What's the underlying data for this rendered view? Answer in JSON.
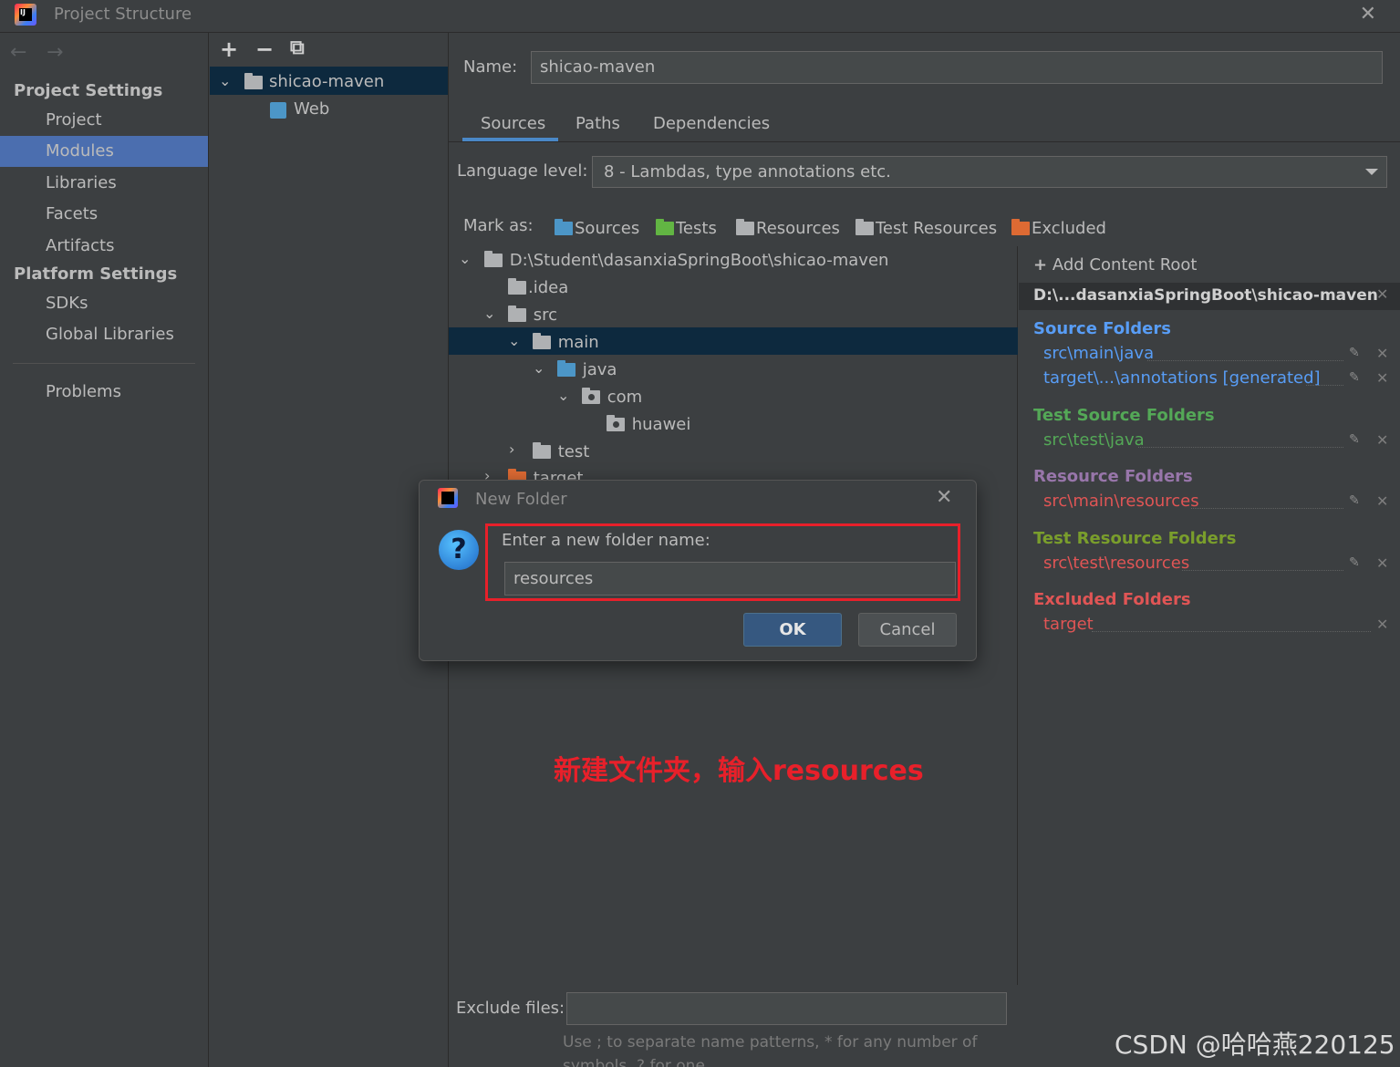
{
  "window": {
    "title": "Project Structure",
    "close": "✕"
  },
  "nav": {
    "back": "←",
    "forward": "→",
    "project_settings": "Project Settings",
    "project_items": [
      "Project",
      "Modules",
      "Libraries",
      "Facets",
      "Artifacts"
    ],
    "platform_settings": "Platform Settings",
    "platform_items": [
      "SDKs",
      "Global Libraries"
    ],
    "problems": "Problems"
  },
  "modules": {
    "add": "+",
    "remove": "−",
    "copy": "⧉",
    "root": "shicao-maven",
    "child": "Web"
  },
  "main": {
    "name_label": "Name:",
    "name_value": "shicao-maven",
    "tabs": [
      "Sources",
      "Paths",
      "Dependencies"
    ],
    "language_label": "Language level:",
    "language_value": "8 - Lambdas, type annotations etc.",
    "mark_as": "Mark as:",
    "mark_buttons": [
      "Sources",
      "Tests",
      "Resources",
      "Test Resources",
      "Excluded"
    ],
    "tree": {
      "root": "D:\\Student\\dasanxiaSpringBoot\\shicao-maven",
      "idea": ".idea",
      "src": "src",
      "main": "main",
      "java": "java",
      "com": "com",
      "huawei": "huawei",
      "test": "test",
      "target": "target"
    },
    "exclude_label": "Exclude files:",
    "exclude_hint": "Use ; to separate name patterns, * for any number of symbols, ? for one."
  },
  "roots": {
    "add_content_root": "Add Content Root",
    "root_path": "D:\\...dasanxiaSpringBoot\\shicao-maven",
    "source_folders": "Source Folders",
    "source_items": [
      "src\\main\\java",
      "target\\...\\annotations [generated]"
    ],
    "test_source_folders": "Test Source Folders",
    "test_source_items": [
      "src\\test\\java"
    ],
    "resource_folders": "Resource Folders",
    "resource_items": [
      "src\\main\\resources"
    ],
    "test_resource_folders": "Test Resource Folders",
    "test_resource_items": [
      "src\\test\\resources"
    ],
    "excluded_folders": "Excluded Folders",
    "excluded_items": [
      "target"
    ],
    "colors": {
      "source": "#589df6",
      "test": "#54a857",
      "resource": "#9876aa",
      "test_resource": "#7a9e2c",
      "excluded": "#e05555"
    }
  },
  "dialog": {
    "title": "New Folder",
    "prompt": "Enter a new folder name:",
    "value": "resources",
    "ok": "OK",
    "cancel": "Cancel"
  },
  "annotation": "新建文件夹，输入resources",
  "watermark": "CSDN @哈哈燕220125"
}
